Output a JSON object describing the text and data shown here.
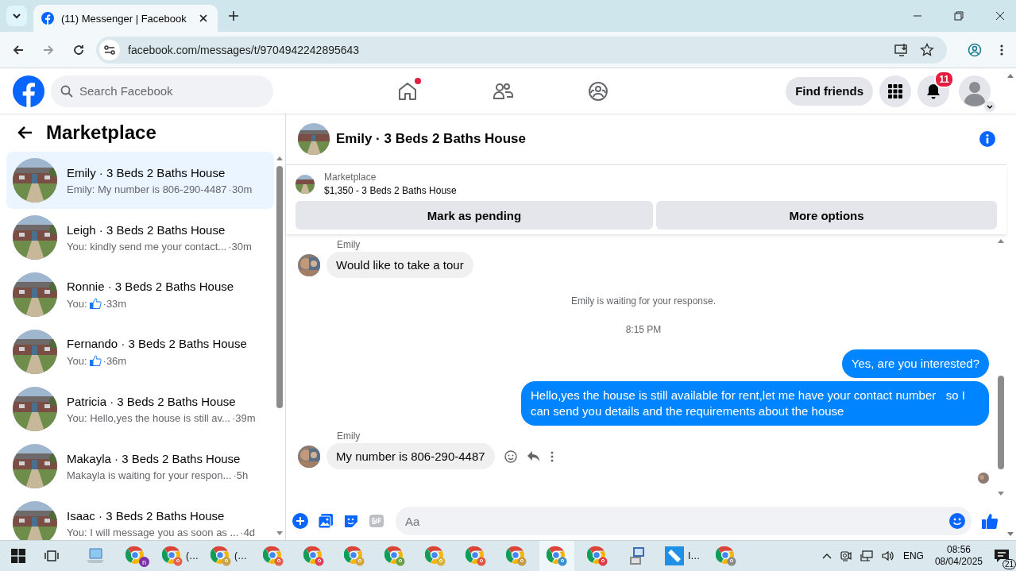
{
  "browser": {
    "tab": {
      "title": "(11) Messenger | Facebook"
    },
    "url": "facebook.com/messages/t/9704942242895643"
  },
  "header": {
    "search": {
      "placeholder": "Search Facebook"
    },
    "home_dot": true,
    "find_friends": "Find friends",
    "notifications": "11"
  },
  "sidebar": {
    "title": "Marketplace",
    "conversations": [
      {
        "title": "Emily · 3 Beds 2 Baths House",
        "preview": "Emily: My number is 806-290-4487",
        "like": false,
        "time": "·30m",
        "selected": true
      },
      {
        "title": "Leigh · 3 Beds 2 Baths House",
        "preview": "You: kindly send me your contact...",
        "like": false,
        "time": "·30m",
        "selected": false
      },
      {
        "title": "Ronnie · 3 Beds 2 Baths House",
        "preview": "You:",
        "like": true,
        "time": "·33m",
        "selected": false
      },
      {
        "title": "Fernando · 3 Beds 2 Baths House",
        "preview": "You:",
        "like": true,
        "time": "·36m",
        "selected": false
      },
      {
        "title": "Patricia · 3 Beds 2 Baths House",
        "preview": "You: Hello,yes the house is still av...",
        "like": false,
        "time": "·39m",
        "selected": false
      },
      {
        "title": "Makayla · 3 Beds 2 Baths House",
        "preview": "Makayla is waiting for your respon...",
        "like": false,
        "time": "·5h",
        "selected": false
      },
      {
        "title": "Isaac · 3 Beds 2 Baths House",
        "preview": "You: I will message you as soon as ...",
        "like": false,
        "time": "·4d",
        "selected": false
      }
    ]
  },
  "chat": {
    "title": "Emily · 3 Beds 2 Baths House",
    "listing": {
      "label": "Marketplace",
      "name": "$1,350 - 3 Beds 2 Baths House"
    },
    "buttons": [
      "Mark as pending",
      "More options"
    ],
    "messages": [
      {
        "kind": "incoming",
        "sender": "Emily",
        "text": "Would like to take a tour",
        "hovered": false
      },
      {
        "kind": "notice",
        "text": "Emily is waiting for your response."
      },
      {
        "kind": "time",
        "text": "8:15 PM"
      },
      {
        "kind": "outgoing",
        "text": "Yes, are you interested?"
      },
      {
        "kind": "outgoing",
        "text": "Hello,yes the house is still available for rent,let me have your contact number   so I can send you details and the requirements about the house"
      },
      {
        "kind": "incoming",
        "sender": "Emily",
        "text": "My number is 806-290-4487",
        "hovered": true
      }
    ],
    "composer": {
      "placeholder": "Aa"
    }
  },
  "taskbar": {
    "apps": [
      {
        "kind": "laptop",
        "selected": false
      },
      {
        "kind": "chrome",
        "color": "#7b2fa8",
        "badge": "n",
        "selected": false
      },
      {
        "kind": "chrome",
        "color": "#e8604c",
        "label": "(…",
        "selected": false
      },
      {
        "kind": "chrome",
        "color": "#c9a24a",
        "label": "(…",
        "selected": false
      },
      {
        "kind": "chrome",
        "color": "#e8604c",
        "selected": false
      },
      {
        "kind": "chrome",
        "color": "#e0405a",
        "selected": false
      },
      {
        "kind": "chrome",
        "color": "#d5a43c",
        "selected": false
      },
      {
        "kind": "chrome",
        "color": "#6ca04a",
        "selected": false
      },
      {
        "kind": "chrome",
        "color": "#d8b23a",
        "selected": false
      },
      {
        "kind": "chrome",
        "color": "#e05545",
        "selected": false
      },
      {
        "kind": "chrome",
        "color": "#c59a40",
        "selected": false
      },
      {
        "kind": "chrome",
        "color": "#3a8fd0",
        "selected": true
      },
      {
        "kind": "chrome",
        "color": "#e03a4a",
        "selected": false
      },
      {
        "kind": "program",
        "selected": false
      },
      {
        "kind": "drive",
        "label": "I…",
        "selected": false
      },
      {
        "kind": "chrome",
        "color": "#8a8a8a",
        "selected": false
      }
    ],
    "language": "ENG",
    "time": "08:56",
    "date": "08/04/2025",
    "notifications": "21"
  }
}
